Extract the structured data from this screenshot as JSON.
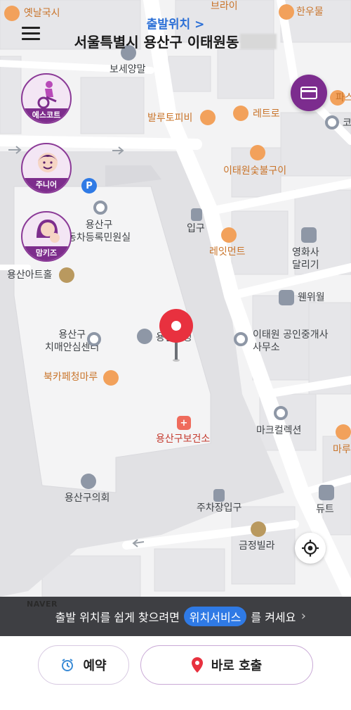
{
  "header": {
    "pickup_label": "출발위치 >",
    "address": "서울특별시 용산구 이태원동"
  },
  "services": [
    {
      "label": "에스코트"
    },
    {
      "label": "주니어"
    },
    {
      "label": "맘키즈"
    }
  ],
  "map": {
    "provider": "NAVER",
    "pois": [
      {
        "name": "옛날국시"
      },
      {
        "name": "브라이"
      },
      {
        "name": "한우물"
      },
      {
        "name": "보세양말"
      },
      {
        "name": "레트로"
      },
      {
        "name": "발루토피비"
      },
      {
        "name": "이태원숯불구이"
      },
      {
        "name": "입구"
      },
      {
        "name": "용산구\n동차등록민원실"
      },
      {
        "name": "레잇먼트"
      },
      {
        "name": "영화사\n달리기"
      },
      {
        "name": "용산아트홀"
      },
      {
        "name": "웬위월"
      },
      {
        "name": "용산구\n치매안심센터"
      },
      {
        "name": "용산구청"
      },
      {
        "name": "이태원 공인중개사\n사무소"
      },
      {
        "name": "북카페청마루"
      },
      {
        "name": "마크컬렉션"
      },
      {
        "name": "용산구보건소"
      },
      {
        "name": "마루"
      },
      {
        "name": "용산구의회"
      },
      {
        "name": "듀트"
      },
      {
        "name": "주차장입구"
      },
      {
        "name": "금정빌라"
      },
      {
        "name": "파스"
      },
      {
        "name": "코"
      }
    ]
  },
  "banner": {
    "prefix": "출발 위치를 쉽게 찾으려면",
    "pill": "위치서비스",
    "suffix": "를 켜세요"
  },
  "buttons": {
    "reserve": "예약",
    "call_now": "바로 호출"
  },
  "colors": {
    "brand_purple": "#7c2c8e",
    "pin_red": "#e8313f",
    "link_blue": "#2f7ae5"
  }
}
